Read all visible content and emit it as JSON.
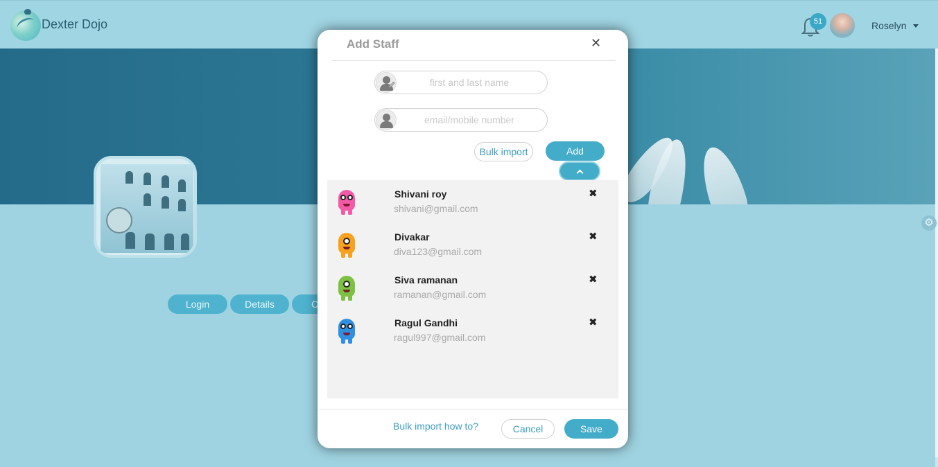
{
  "app": {
    "brand": "Dexter Dojo",
    "notification_count": "51",
    "user_name": "Roselyn"
  },
  "profile": {
    "tabs": [
      {
        "label": "Login"
      },
      {
        "label": "Details"
      },
      {
        "label": "C"
      }
    ]
  },
  "modal": {
    "title": "Add Staff",
    "name_placeholder": "first and last name",
    "contact_placeholder": "email/mobile number",
    "bulk_import_label": "Bulk import",
    "add_label": "Add",
    "staff": [
      {
        "name": "Shivani roy",
        "email": "shivani@gmail.com",
        "avatar": "pink-monster-icon",
        "color": "#f25aa8"
      },
      {
        "name": "Divakar",
        "email": "diva123@gmail.com",
        "avatar": "orange-monster-icon",
        "color": "#f6a21e"
      },
      {
        "name": "Siva ramanan",
        "email": "ramanan@gmail.com",
        "avatar": "green-monster-icon",
        "color": "#7dc142"
      },
      {
        "name": "Ragul Gandhi",
        "email": "ragul997@gmail.com",
        "avatar": "blue-monster-icon",
        "color": "#2f8fe0"
      }
    ],
    "howto_label": "Bulk import how to?",
    "cancel_label": "Cancel",
    "save_label": "Save"
  },
  "colors": {
    "accent": "#43acc9",
    "page_bg": "#9fd3e1",
    "banner": "#2d7895"
  }
}
